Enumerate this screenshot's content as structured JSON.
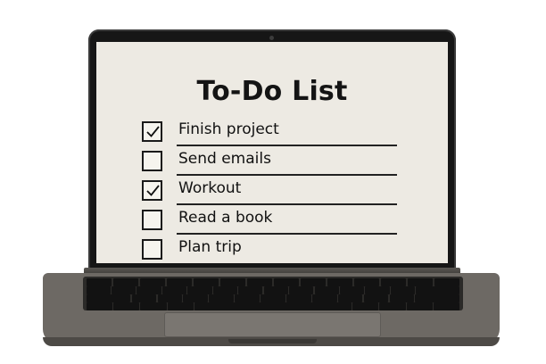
{
  "app": {
    "title": "To-Do List",
    "items": [
      {
        "label": "Finish project",
        "checked": true
      },
      {
        "label": "Send emails",
        "checked": false
      },
      {
        "label": "Workout",
        "checked": true
      },
      {
        "label": "Read a book",
        "checked": false
      },
      {
        "label": "Plan trip",
        "checked": false
      }
    ]
  },
  "icons": {
    "check": "check-icon"
  }
}
